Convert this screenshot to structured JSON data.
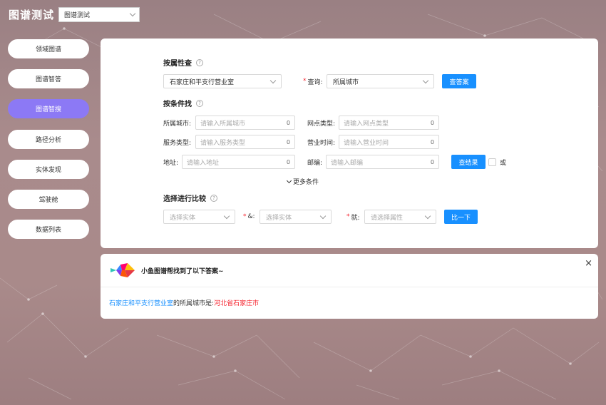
{
  "app": {
    "title": "图谱测试",
    "graph_select": "图谱测试"
  },
  "sidebar": {
    "items": [
      {
        "label": "领域图谱",
        "active": false
      },
      {
        "label": "图谱智答",
        "active": false
      },
      {
        "label": "图谱智搜",
        "active": true
      },
      {
        "label": "路径分析",
        "active": false
      },
      {
        "label": "实体发现",
        "active": false
      },
      {
        "label": "驾驶舱",
        "active": false
      },
      {
        "label": "数据列表",
        "active": false
      }
    ]
  },
  "attr_query": {
    "title": "按属性查",
    "entity_value": "石家庄和平支行营业室",
    "query_label": "查询:",
    "query_value": "所属城市",
    "button": "查答案"
  },
  "cond_search": {
    "title": "按条件找",
    "fields": {
      "city": {
        "label": "所属城市:",
        "placeholder": "请输入所属城市",
        "count": "0"
      },
      "outlet_type": {
        "label": "网点类型:",
        "placeholder": "请输入网点类型",
        "count": "0"
      },
      "service_type": {
        "label": "服务类型:",
        "placeholder": "请输入服务类型",
        "count": "0"
      },
      "business_hours": {
        "label": "营业时间:",
        "placeholder": "请输入营业时间",
        "count": "0"
      },
      "address": {
        "label": "地址:",
        "placeholder": "请输入地址",
        "count": "0"
      },
      "postcode": {
        "label": "邮编:",
        "placeholder": "请输入邮编",
        "count": "0"
      }
    },
    "button": "查结果",
    "or_label": "或",
    "more": "更多条件"
  },
  "compare": {
    "title": "选择进行比较",
    "entity1_placeholder": "选择实体",
    "amp_label": "&:",
    "entity2_placeholder": "选择实体",
    "attr_label": "就:",
    "attr_placeholder": "请选择属性",
    "button": "比一下"
  },
  "answer": {
    "title": "小鱼图谱帮找到了以下答案~",
    "entity": "石家庄和平支行营业室",
    "middle": "的所属城市是:",
    "value": "河北省石家庄市",
    "close": "×"
  },
  "colors": {
    "accent": "#1890ff",
    "active_nav": "#8c79f5",
    "required": "#f5222d"
  }
}
